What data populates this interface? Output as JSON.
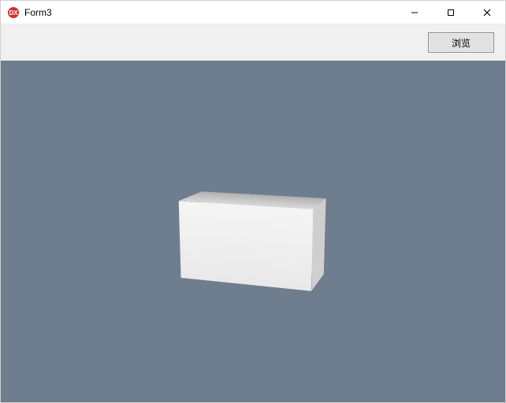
{
  "window": {
    "title": "Form3",
    "controls": {
      "minimize": "—",
      "maximize": "□",
      "close": "✕"
    }
  },
  "toolbar": {
    "browse_label": "浏览"
  },
  "viewport": {
    "object": "3d-box",
    "background": "#6f7e8e"
  }
}
